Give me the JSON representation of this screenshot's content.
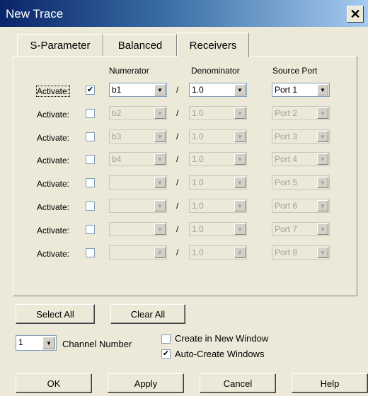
{
  "window": {
    "title": "New Trace",
    "close_glyph": "✕"
  },
  "tabs": [
    {
      "label": "S-Parameter",
      "active": false
    },
    {
      "label": "Balanced",
      "active": false
    },
    {
      "label": "Receivers",
      "active": true
    }
  ],
  "headers": {
    "numerator": "Numerator",
    "denominator": "Denominator",
    "source_port": "Source Port"
  },
  "rows": [
    {
      "label": "Activate:",
      "checked": true,
      "numerator": "b1",
      "denominator": "1.0",
      "source_port": "Port 1",
      "enabled": true
    },
    {
      "label": "Activate:",
      "checked": false,
      "numerator": "b2",
      "denominator": "1.0",
      "source_port": "Port 2",
      "enabled": false
    },
    {
      "label": "Activate:",
      "checked": false,
      "numerator": "b3",
      "denominator": "1.0",
      "source_port": "Port 3",
      "enabled": false
    },
    {
      "label": "Activate:",
      "checked": false,
      "numerator": "b4",
      "denominator": "1.0",
      "source_port": "Port 4",
      "enabled": false
    },
    {
      "label": "Activate:",
      "checked": false,
      "numerator": "",
      "denominator": "1.0",
      "source_port": "Port 5",
      "enabled": false
    },
    {
      "label": "Activate:",
      "checked": false,
      "numerator": "",
      "denominator": "1.0",
      "source_port": "Port 6",
      "enabled": false
    },
    {
      "label": "Activate:",
      "checked": false,
      "numerator": "",
      "denominator": "1.0",
      "source_port": "Port 7",
      "enabled": false
    },
    {
      "label": "Activate:",
      "checked": false,
      "numerator": "",
      "denominator": "1.0",
      "source_port": "Port 8",
      "enabled": false
    }
  ],
  "separator": "/",
  "buttons": {
    "select_all": "Select All",
    "clear_all": "Clear All",
    "ok": "OK",
    "apply": "Apply",
    "cancel": "Cancel",
    "help": "Help"
  },
  "channel": {
    "value": "1",
    "label": "Channel Number"
  },
  "options": {
    "create_new_window": {
      "label": "Create in New Window",
      "checked": false
    },
    "auto_create": {
      "label": "Auto-Create Windows",
      "checked": true
    }
  },
  "colors": {
    "title_bar": "#0a246a",
    "dialog_bg": "#ece9d8"
  }
}
